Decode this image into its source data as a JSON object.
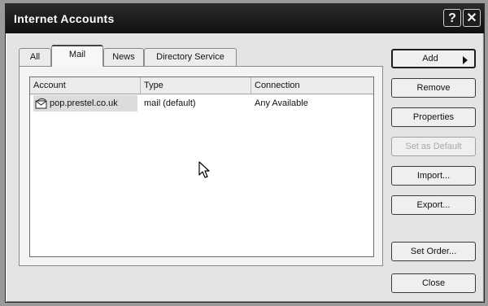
{
  "window": {
    "title": "Internet Accounts",
    "help_glyph": "?",
    "close_glyph": "✕"
  },
  "tabs": [
    {
      "label": "All"
    },
    {
      "label": "Mail"
    },
    {
      "label": "News"
    },
    {
      "label": "Directory Service"
    }
  ],
  "active_tab": "Mail",
  "list": {
    "columns": [
      "Account",
      "Type",
      "Connection"
    ],
    "rows": [
      {
        "account": "pop.prestel.co.uk",
        "type": "mail (default)",
        "connection": "Any Available"
      }
    ]
  },
  "buttons": {
    "add": "Add",
    "remove": "Remove",
    "properties": "Properties",
    "set_default": "Set as Default",
    "import": "Import...",
    "export": "Export...",
    "set_order": "Set Order...",
    "close": "Close"
  },
  "icons": {
    "account": "mail-account-icon",
    "add_arrow": "right-arrow-icon",
    "cursor": "mouse-cursor-icon"
  }
}
